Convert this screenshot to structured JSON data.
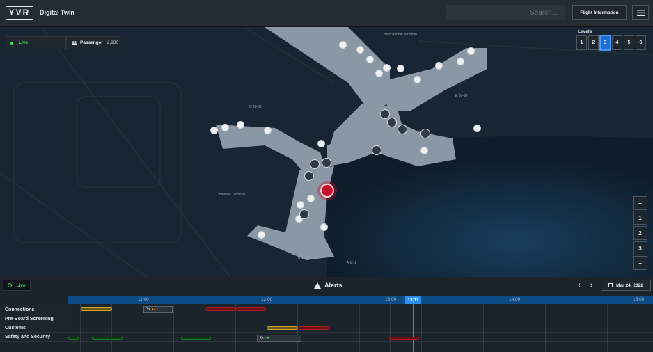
{
  "header": {
    "logo_text": "YVR",
    "app_title": "Digital Twin",
    "search_placeholder": "Search...",
    "flight_info_label": "Flight Information",
    "menu_icon": "hamburger-menu-icon"
  },
  "status": {
    "live_label": "Live",
    "passenger_label": "Passenger",
    "passenger_count": "2,980"
  },
  "levels": {
    "label": "Levels",
    "items": [
      "1",
      "2",
      "3",
      "4",
      "5",
      "6"
    ],
    "active": "3"
  },
  "map": {
    "labels": {
      "intl": "International Terminal",
      "e": "E 67-99",
      "c": "C 29-52",
      "domestic": "Domestic Terminal",
      "b": "B 11-28",
      "a": "A 1-12"
    }
  },
  "zoom": {
    "plus": "+",
    "minus": "−",
    "floors": [
      "1",
      "2",
      "3"
    ]
  },
  "timeline": {
    "live_label": "Live",
    "alerts_title": "Alerts",
    "date": "Mar 24, 2022",
    "ticks": [
      "11:00",
      "12:00",
      "13:00",
      "14:00",
      "15:00"
    ],
    "now": "13:11",
    "rows": [
      "Connections",
      "Pre-Board Screening",
      "Customs",
      "Safety and Security"
    ],
    "cluster_1": "3x",
    "cluster_2": "2x"
  },
  "colors": {
    "accent": "#1d6fd2",
    "live": "#47e35b",
    "alert": "#c8102e",
    "warning": "#d3a61f"
  }
}
